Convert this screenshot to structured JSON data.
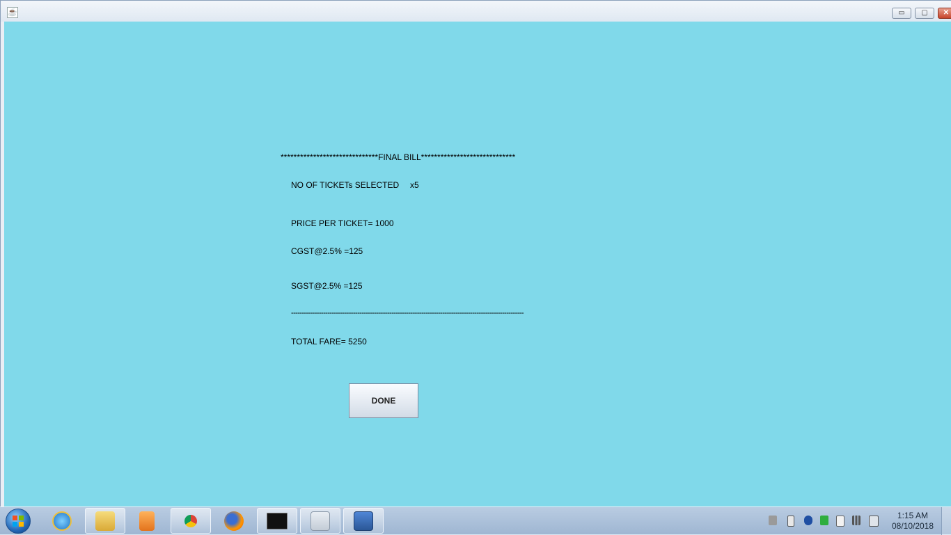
{
  "window": {
    "controls": {
      "minimize": "▭",
      "maximize": "▢",
      "close": "✕"
    }
  },
  "bill": {
    "header": "******************************FINAL BILL*****************************",
    "tickets_label": "NO OF TICKETs SELECTED",
    "tickets_value": "x5",
    "price_line": "PRICE PER TICKET= 1000",
    "cgst_line": "CGST@2.5% =125",
    "sgst_line": "SGST@2.5% =125",
    "separator": "-------------------------------------------------------------------------------------------------------------",
    "total_line": "TOTAL FARE= 5250",
    "done_label": "DONE"
  },
  "taskbar": {
    "apps": [
      {
        "name": "internet-explorer-icon",
        "color": "#1e73c8"
      },
      {
        "name": "file-explorer-icon",
        "color": "#e6c25a"
      },
      {
        "name": "media-player-icon",
        "color": "#f08a24"
      },
      {
        "name": "chrome-icon",
        "color": "#db4437"
      },
      {
        "name": "firefox-icon",
        "color": "#e66000"
      },
      {
        "name": "command-prompt-icon",
        "color": "#111111"
      },
      {
        "name": "java-icon",
        "color": "#5382a1"
      },
      {
        "name": "word-icon",
        "color": "#2b5797"
      }
    ],
    "clock": {
      "time": "1:15 AM",
      "date": "08/10/2018"
    }
  },
  "colors": {
    "client_background": "#80d9ea",
    "titlebar": "#dfe8f2",
    "taskbar": "#aebfd6"
  }
}
